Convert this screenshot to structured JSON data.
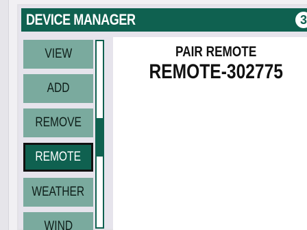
{
  "header": {
    "title": "DEVICE MANAGER",
    "badge": "3"
  },
  "menu": {
    "items": [
      {
        "label": "VIEW"
      },
      {
        "label": "ADD"
      },
      {
        "label": "REMOVE"
      },
      {
        "label": "REMOTE"
      },
      {
        "label": "WEATHER"
      },
      {
        "label": "WIND"
      }
    ],
    "active": "REMOTE"
  },
  "content": {
    "title": "PAIR REMOTE",
    "value": "REMOTE-302775"
  },
  "colors": {
    "accent": "#0f6150",
    "menu_item": "#7aaa9e",
    "background": "#e6e4ec"
  }
}
